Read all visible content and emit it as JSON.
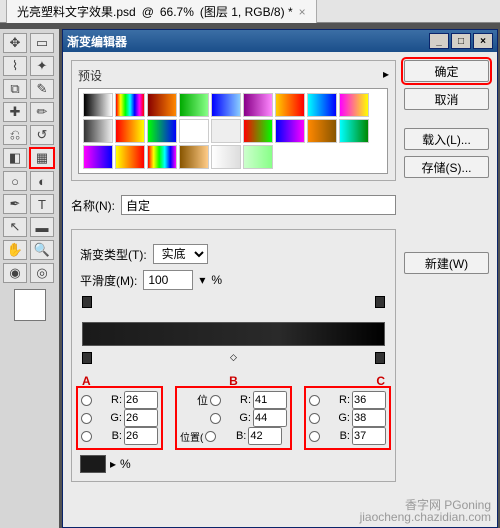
{
  "tab": {
    "filename": "光亮塑料文字效果.psd",
    "zoom": "66.7%",
    "layer": "图层 1",
    "mode": "RGB/8",
    "close": "×"
  },
  "tools": {
    "swatch_fg": "#ffffff",
    "gradient_icon": "▦"
  },
  "dialog": {
    "title": "渐变编辑器",
    "btn_min": "_",
    "btn_max": "□",
    "btn_close": "×",
    "ok": "确定",
    "cancel": "取消",
    "load": "载入(L)...",
    "save": "存储(S)...",
    "new": "新建(W)",
    "preset_label": "预设",
    "preset_menu": "▸",
    "name_label": "名称(N):",
    "name_value": "自定",
    "type_label": "渐变类型(T):",
    "type_value": "实底",
    "smooth_label": "平滑度(M):",
    "smooth_value": "100",
    "smooth_unit": "%",
    "abc": [
      "A",
      "B",
      "C"
    ],
    "pos_short": "位",
    "pos_label": "位置(",
    "pct": "%",
    "stops": [
      {
        "r": "26",
        "g": "26",
        "b": "26"
      },
      {
        "r": "41",
        "g": "44",
        "b": "42"
      },
      {
        "r": "36",
        "g": "38",
        "b": "37"
      }
    ],
    "presets": [
      "#000,#fff",
      "#f00,#ff0,#0f0,#0ff,#00f,#f0f,#f00",
      "#800,#f80",
      "#0a0,#8f8",
      "#00f,#8cf",
      "#808,#f8f",
      "#fc0,#f00",
      "#0ff,#00f",
      "#f0f,#ff0",
      "#333,#eee",
      "#f00,#ff0",
      "#0f0,#00f",
      "#fff,#fff",
      "#eee,#eee",
      "#f00,#0f0",
      "#00f,#f0f",
      "#f80,#850",
      "#0ff,#080",
      "#f0f,#00f",
      "#ff0,#f00",
      "#f00,#ff0,#0f0,#0ff,#00f,#f0f",
      "#850,#fc8",
      "#fff,#ddd",
      "#cfc,#8f8"
    ]
  },
  "watermark": {
    "l1": "香字网 PGoning",
    "l2": "jiaocheng.chazidian.com"
  }
}
